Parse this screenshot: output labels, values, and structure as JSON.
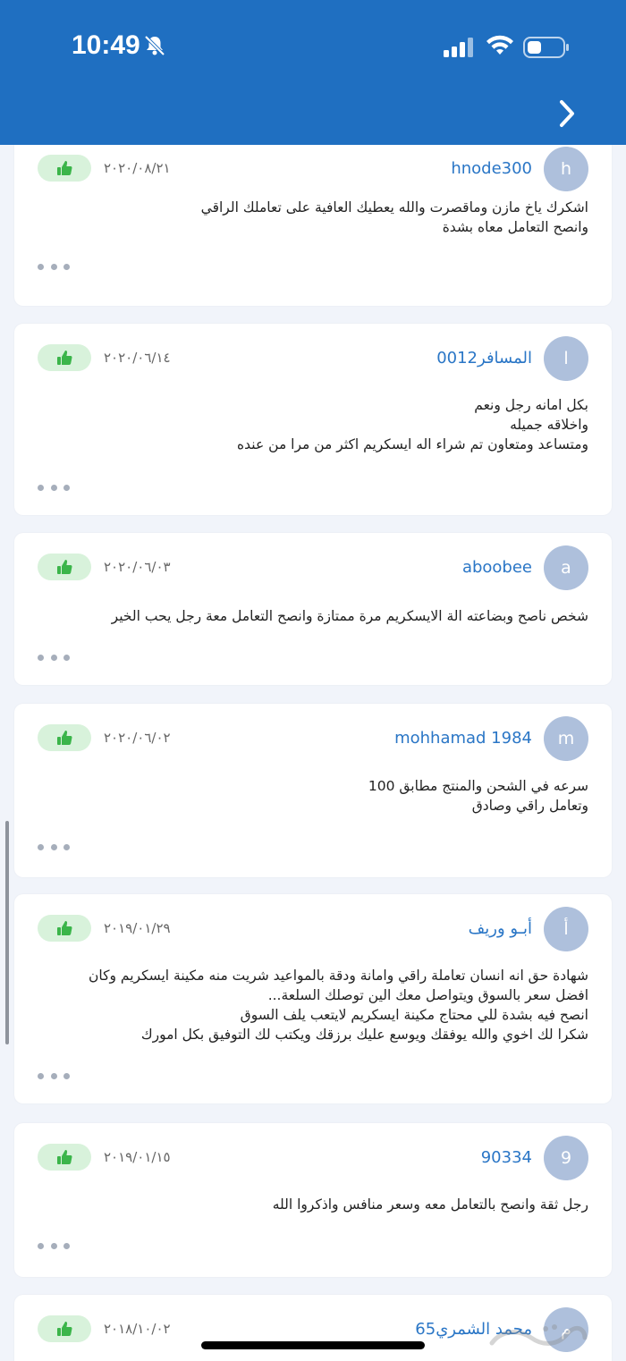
{
  "status_bar": {
    "time": "10:49"
  },
  "reviews": [
    {
      "avatar": "h",
      "username": "hnode300",
      "date": "٢٠٢٠/٠٨/٢١",
      "comment": "اشكرك ياخ مازن وماقصرت والله يعطيك العافية على تعاملك الراقي\nوانصح التعامل معاه بشدة"
    },
    {
      "avatar": "ا",
      "username": "المسافر0012",
      "date": "٢٠٢٠/٠٦/١٤",
      "comment": "بكل امانه رجل ونعم\nواخلاقه جميله\nومتساعد ومتعاون تم شراء اله ايسكريم اكثر من مرا من عنده"
    },
    {
      "avatar": "a",
      "username": "aboobee",
      "date": "٢٠٢٠/٠٦/٠٣",
      "comment": "شخص ناصح وبضاعته الة الايسكريم مرة ممتازة وانصح التعامل معة رجل يحب الخير"
    },
    {
      "avatar": "m",
      "username": "mohhamad 1984",
      "date": "٢٠٢٠/٠٦/٠٢",
      "comment": "سرعه في الشحن والمنتج مطابق 100\nوتعامل راقي وصادق"
    },
    {
      "avatar": "أ",
      "username": "أبـو وريف",
      "date": "٢٠١٩/٠١/٢٩",
      "comment": "شهادة حق انه انسان تعاملة راقي وامانة ودقة بالمواعيد شريت منه مكينة ايسكريم وكان\nافضل سعر بالسوق ويتواصل معك الين توصلك السلعة...\nانصح فيه بشدة للي محتاج مكينة ايسكريم لايتعب يلف السوق\nشكرا لك اخوي والله يوفقك ويوسع عليك برزقك ويكتب لك التوفيق بكل امورك"
    },
    {
      "avatar": "9",
      "username": "90334",
      "date": "٢٠١٩/٠١/١٥",
      "comment": "رجل ثقة وانصح بالتعامل معه وسعر منافس واذكروا الله"
    },
    {
      "avatar": "م",
      "username": "محمد الشمري65",
      "date": "٢٠١٨/١٠/٠٢",
      "comment": ""
    }
  ],
  "colors": {
    "header": "#1f6fc1",
    "accent": "#2a76c6",
    "like_bg": "#d8f2db",
    "like_icon": "#3bb54a",
    "avatar_bg": "#aec0dc"
  },
  "icons": {
    "back": "chevron-right-icon",
    "like": "thumbs-up-icon",
    "more": "more-dots-icon",
    "mute": "bell-slash-icon"
  }
}
